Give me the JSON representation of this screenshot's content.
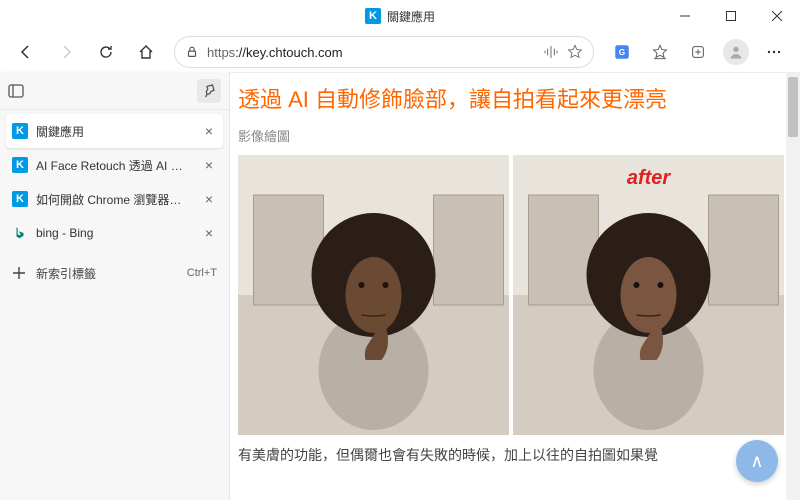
{
  "window": {
    "title": "關鍵應用"
  },
  "toolbar": {
    "url_scheme": "https",
    "url_host": "://key.chtouch.com"
  },
  "vtabs": {
    "items": [
      {
        "label": "關鍵應用",
        "favicon": "k",
        "active": true
      },
      {
        "label": "AI Face Retouch 透過 AI 自動修飾",
        "favicon": "k",
        "active": false
      },
      {
        "label": "如何開啟 Chrome 瀏覽器的 Tab S",
        "favicon": "k",
        "active": false
      },
      {
        "label": "bing - Bing",
        "favicon": "b",
        "active": false
      }
    ],
    "new_tab_label": "新索引標籤",
    "new_tab_shortcut": "Ctrl+T"
  },
  "article": {
    "title_fragment": "透過 AI 自動修飾臉部，讓自拍看起來更漂亮",
    "meta": "影像繪圖",
    "after_label": "after",
    "body_fragment": "有美膚的功能，但偶爾也會有失敗的時候，加上以往的自拍圖如果覺"
  },
  "fab": {
    "glyph": "∧"
  }
}
